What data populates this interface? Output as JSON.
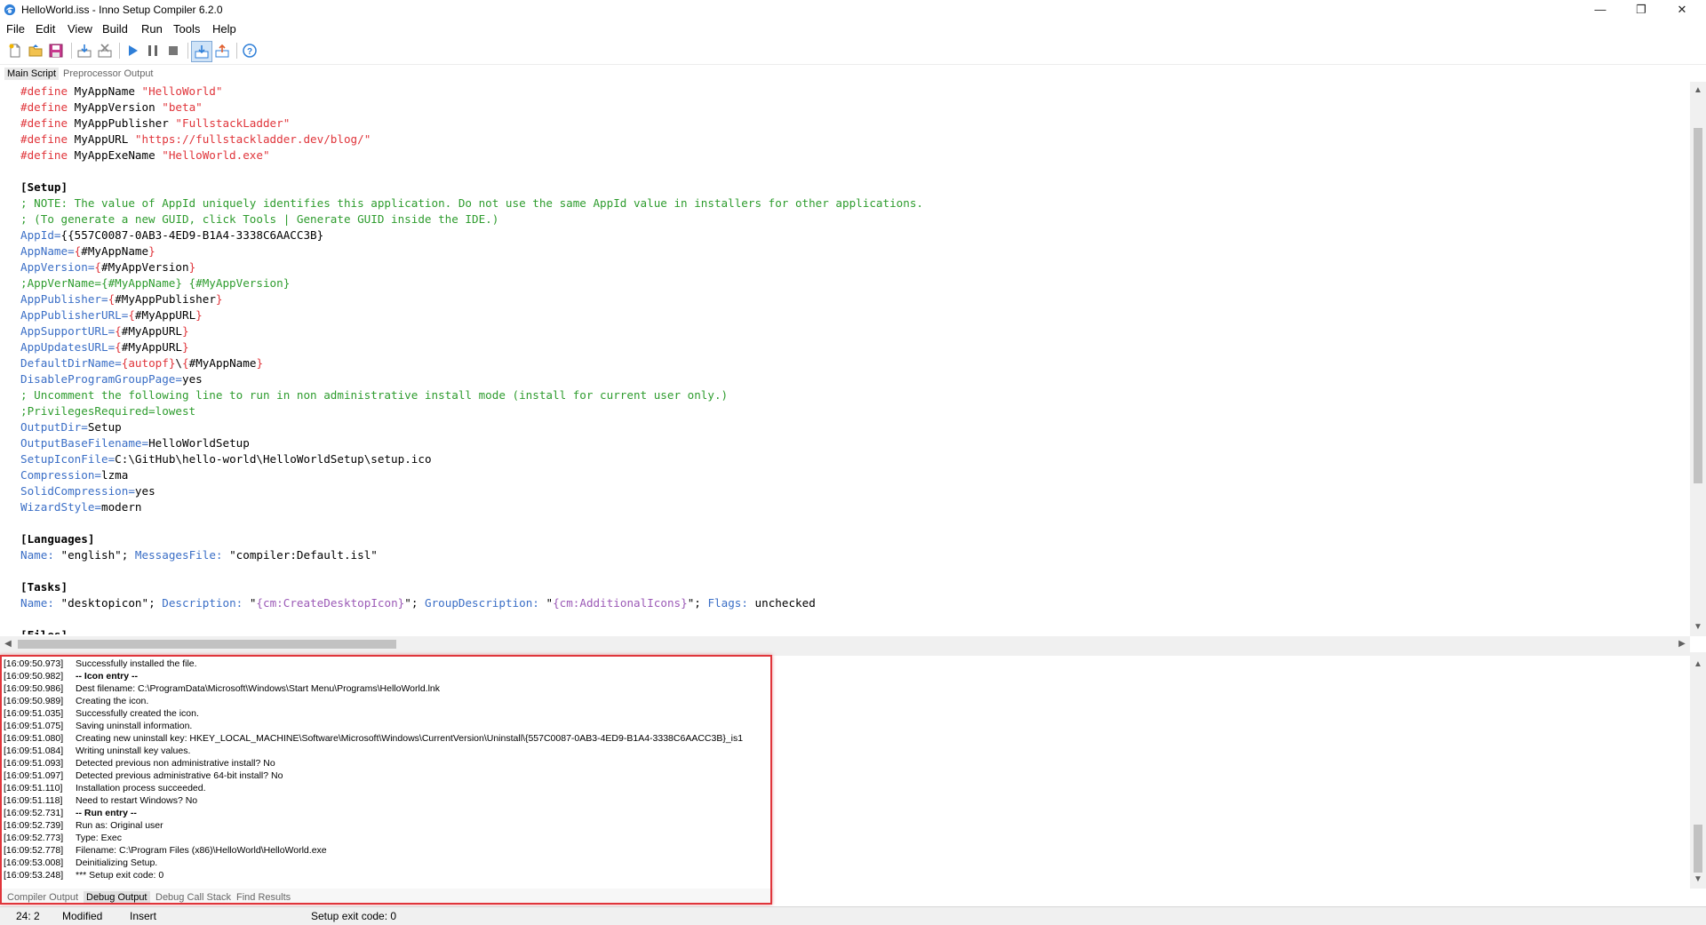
{
  "window": {
    "title": "HelloWorld.iss - Inno Setup Compiler 6.2.0",
    "minimize": "—",
    "restore": "❐",
    "close": "✕"
  },
  "menu": [
    "File",
    "Edit",
    "View",
    "Build",
    "Run",
    "Tools",
    "Help"
  ],
  "toolbar": {
    "buttons": [
      "new-file-icon",
      "open-folder-icon",
      "save-icon",
      "compile-icon",
      "stop-compile-icon",
      "run-icon",
      "pause-icon",
      "terminate-icon",
      "target-setup-icon",
      "target-uninstall-icon",
      "help-icon"
    ]
  },
  "editor_tabs": [
    "Main Script",
    "Preprocessor Output"
  ],
  "colors": {
    "directive": "#e0353b",
    "string": "#e0353b",
    "section": "#000000",
    "comment": "#2e9c2e",
    "key": "#3a6ec6",
    "constant": "#9b59b6",
    "plain": "#000000",
    "highlight": "#e0353b"
  },
  "code": [
    [
      {
        "t": "#define",
        "c": "directive"
      },
      {
        "t": " MyAppName ",
        "c": "plain"
      },
      {
        "t": "\"HelloWorld\"",
        "c": "string"
      }
    ],
    [
      {
        "t": "#define",
        "c": "directive"
      },
      {
        "t": " MyAppVersion ",
        "c": "plain"
      },
      {
        "t": "\"beta\"",
        "c": "string"
      }
    ],
    [
      {
        "t": "#define",
        "c": "directive"
      },
      {
        "t": " MyAppPublisher ",
        "c": "plain"
      },
      {
        "t": "\"FullstackLadder\"",
        "c": "string"
      }
    ],
    [
      {
        "t": "#define",
        "c": "directive"
      },
      {
        "t": " MyAppURL ",
        "c": "plain"
      },
      {
        "t": "\"https://fullstackladder.dev/blog/\"",
        "c": "string"
      }
    ],
    [
      {
        "t": "#define",
        "c": "directive"
      },
      {
        "t": " MyAppExeName ",
        "c": "plain"
      },
      {
        "t": "\"HelloWorld.exe\"",
        "c": "string"
      }
    ],
    [],
    [
      {
        "t": "[Setup]",
        "c": "section"
      }
    ],
    [
      {
        "t": "; NOTE: The value of AppId uniquely identifies this application. Do not use the same AppId value in installers for other applications.",
        "c": "comment"
      }
    ],
    [
      {
        "t": "; (To generate a new GUID, click Tools | Generate GUID inside the IDE.)",
        "c": "comment"
      }
    ],
    [
      {
        "t": "AppId",
        "c": "key"
      },
      {
        "t": "=",
        "c": "key"
      },
      {
        "t": "{{557C0087-0AB3-4ED9-B1A4-3338C6AACC3B}",
        "c": "plain"
      }
    ],
    [
      {
        "t": "AppName",
        "c": "key"
      },
      {
        "t": "=",
        "c": "key"
      },
      {
        "t": "{",
        "c": "string"
      },
      {
        "t": "#MyAppName",
        "c": "plain"
      },
      {
        "t": "}",
        "c": "string"
      }
    ],
    [
      {
        "t": "AppVersion",
        "c": "key"
      },
      {
        "t": "=",
        "c": "key"
      },
      {
        "t": "{",
        "c": "string"
      },
      {
        "t": "#MyAppVersion",
        "c": "plain"
      },
      {
        "t": "}",
        "c": "string"
      }
    ],
    [
      {
        "t": ";AppVerName={#MyAppName} {#MyAppVersion}",
        "c": "comment"
      }
    ],
    [
      {
        "t": "AppPublisher",
        "c": "key"
      },
      {
        "t": "=",
        "c": "key"
      },
      {
        "t": "{",
        "c": "string"
      },
      {
        "t": "#MyAppPublisher",
        "c": "plain"
      },
      {
        "t": "}",
        "c": "string"
      }
    ],
    [
      {
        "t": "AppPublisherURL",
        "c": "key"
      },
      {
        "t": "=",
        "c": "key"
      },
      {
        "t": "{",
        "c": "string"
      },
      {
        "t": "#MyAppURL",
        "c": "plain"
      },
      {
        "t": "}",
        "c": "string"
      }
    ],
    [
      {
        "t": "AppSupportURL",
        "c": "key"
      },
      {
        "t": "=",
        "c": "key"
      },
      {
        "t": "{",
        "c": "string"
      },
      {
        "t": "#MyAppURL",
        "c": "plain"
      },
      {
        "t": "}",
        "c": "string"
      }
    ],
    [
      {
        "t": "AppUpdatesURL",
        "c": "key"
      },
      {
        "t": "=",
        "c": "key"
      },
      {
        "t": "{",
        "c": "string"
      },
      {
        "t": "#MyAppURL",
        "c": "plain"
      },
      {
        "t": "}",
        "c": "string"
      }
    ],
    [
      {
        "t": "DefaultDirName",
        "c": "key"
      },
      {
        "t": "=",
        "c": "key"
      },
      {
        "t": "{autopf}",
        "c": "string"
      },
      {
        "t": "\\",
        "c": "plain"
      },
      {
        "t": "{",
        "c": "string"
      },
      {
        "t": "#MyAppName",
        "c": "plain"
      },
      {
        "t": "}",
        "c": "string"
      }
    ],
    [
      {
        "t": "DisableProgramGroupPage",
        "c": "key"
      },
      {
        "t": "=",
        "c": "key"
      },
      {
        "t": "yes",
        "c": "plain"
      }
    ],
    [
      {
        "t": "; Uncomment the following line to run in non administrative install mode (install for current user only.)",
        "c": "comment"
      }
    ],
    [
      {
        "t": ";PrivilegesRequired=lowest",
        "c": "comment"
      }
    ],
    [
      {
        "t": "OutputDir",
        "c": "key"
      },
      {
        "t": "=",
        "c": "key"
      },
      {
        "t": "Setup",
        "c": "plain"
      }
    ],
    [
      {
        "t": "OutputBaseFilename",
        "c": "key"
      },
      {
        "t": "=",
        "c": "key"
      },
      {
        "t": "HelloWorldSetup",
        "c": "plain"
      }
    ],
    [
      {
        "t": "SetupIconFile",
        "c": "key"
      },
      {
        "t": "=",
        "c": "key"
      },
      {
        "t": "C:\\GitHub\\hello-world\\HelloWorldSetup\\setup.ico",
        "c": "plain"
      }
    ],
    [
      {
        "t": "Compression",
        "c": "key"
      },
      {
        "t": "=",
        "c": "key"
      },
      {
        "t": "lzma",
        "c": "plain"
      }
    ],
    [
      {
        "t": "SolidCompression",
        "c": "key"
      },
      {
        "t": "=",
        "c": "key"
      },
      {
        "t": "yes",
        "c": "plain"
      }
    ],
    [
      {
        "t": "WizardStyle",
        "c": "key"
      },
      {
        "t": "=",
        "c": "key"
      },
      {
        "t": "modern",
        "c": "plain"
      }
    ],
    [],
    [
      {
        "t": "[Languages]",
        "c": "section"
      }
    ],
    [
      {
        "t": "Name:",
        "c": "key"
      },
      {
        "t": " \"english\"; ",
        "c": "plain"
      },
      {
        "t": "MessagesFile:",
        "c": "key"
      },
      {
        "t": " \"compiler:Default.isl\"",
        "c": "plain"
      }
    ],
    [],
    [
      {
        "t": "[Tasks]",
        "c": "section"
      }
    ],
    [
      {
        "t": "Name:",
        "c": "key"
      },
      {
        "t": " \"desktopicon\"; ",
        "c": "plain"
      },
      {
        "t": "Description:",
        "c": "key"
      },
      {
        "t": " \"",
        "c": "plain"
      },
      {
        "t": "{cm:CreateDesktopIcon}",
        "c": "constant"
      },
      {
        "t": "\"; ",
        "c": "plain"
      },
      {
        "t": "GroupDescription:",
        "c": "key"
      },
      {
        "t": " \"",
        "c": "plain"
      },
      {
        "t": "{cm:AdditionalIcons}",
        "c": "constant"
      },
      {
        "t": "\"; ",
        "c": "plain"
      },
      {
        "t": "Flags:",
        "c": "key"
      },
      {
        "t": " unchecked",
        "c": "plain"
      }
    ],
    [],
    [
      {
        "t": "[Files]",
        "c": "section"
      }
    ]
  ],
  "debug_log": [
    {
      "ts": "[16:09:50.973]",
      "msg": "Successfully installed the file.",
      "bold": false
    },
    {
      "ts": "[16:09:50.982]",
      "msg": "-- Icon entry --",
      "bold": true
    },
    {
      "ts": "[16:09:50.986]",
      "msg": "Dest filename: C:\\ProgramData\\Microsoft\\Windows\\Start Menu\\Programs\\HelloWorld.lnk",
      "bold": false
    },
    {
      "ts": "[16:09:50.989]",
      "msg": "Creating the icon.",
      "bold": false
    },
    {
      "ts": "[16:09:51.035]",
      "msg": "Successfully created the icon.",
      "bold": false
    },
    {
      "ts": "[16:09:51.075]",
      "msg": "Saving uninstall information.",
      "bold": false
    },
    {
      "ts": "[16:09:51.080]",
      "msg": "Creating new uninstall key: HKEY_LOCAL_MACHINE\\Software\\Microsoft\\Windows\\CurrentVersion\\Uninstall\\{557C0087-0AB3-4ED9-B1A4-3338C6AACC3B}_is1",
      "bold": false
    },
    {
      "ts": "[16:09:51.084]",
      "msg": "Writing uninstall key values.",
      "bold": false
    },
    {
      "ts": "[16:09:51.093]",
      "msg": "Detected previous non administrative install? No",
      "bold": false
    },
    {
      "ts": "[16:09:51.097]",
      "msg": "Detected previous administrative 64-bit install? No",
      "bold": false
    },
    {
      "ts": "[16:09:51.110]",
      "msg": "Installation process succeeded.",
      "bold": false
    },
    {
      "ts": "[16:09:51.118]",
      "msg": "Need to restart Windows? No",
      "bold": false
    },
    {
      "ts": "[16:09:52.731]",
      "msg": "-- Run entry --",
      "bold": true
    },
    {
      "ts": "[16:09:52.739]",
      "msg": "Run as: Original user",
      "bold": false
    },
    {
      "ts": "[16:09:52.773]",
      "msg": "Type: Exec",
      "bold": false
    },
    {
      "ts": "[16:09:52.778]",
      "msg": "Filename: C:\\Program Files (x86)\\HelloWorld\\HelloWorld.exe",
      "bold": false
    },
    {
      "ts": "[16:09:53.008]",
      "msg": "Deinitializing Setup.",
      "bold": false
    },
    {
      "ts": "[16:09:53.248]",
      "msg": "*** Setup exit code: 0",
      "bold": false
    }
  ],
  "output_tabs": [
    "Compiler Output",
    "Debug Output",
    "Debug Call Stack",
    "Find Results"
  ],
  "status": {
    "position": "24:  2",
    "modified": "Modified",
    "mode": "Insert",
    "message": "Setup exit code: 0"
  }
}
